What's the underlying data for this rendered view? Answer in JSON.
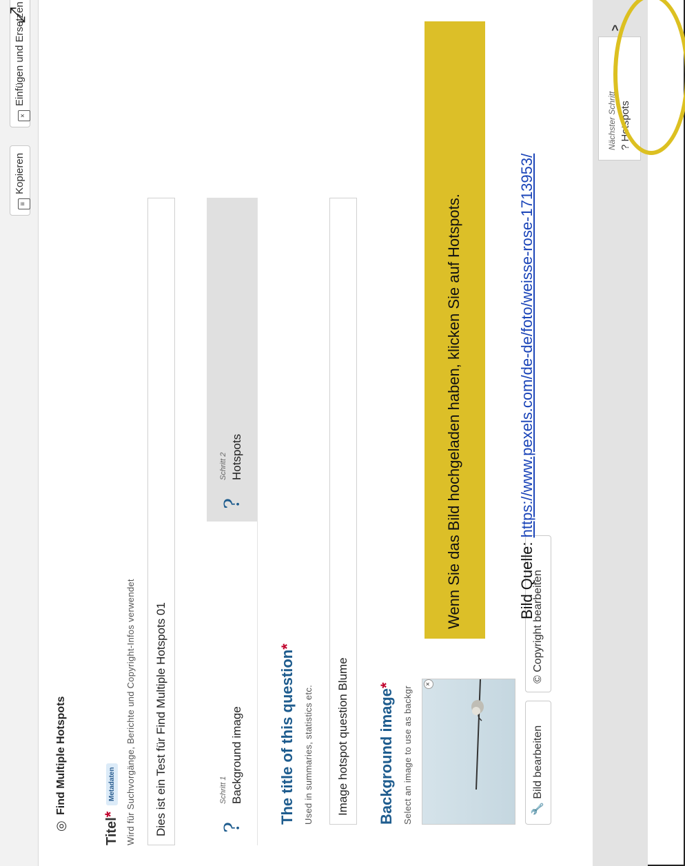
{
  "toolbar": {
    "copy_label": "Kopieren",
    "paste_label": "Einfügen und Ersetzen"
  },
  "editor": {
    "content_type_title": "Find Multiple Hotspots",
    "title_label": "Titel",
    "metadata_badge": "Metadaten",
    "title_hint": "Wird für Suchvorgänge, Berichte und Copyright-Infos verwendet",
    "title_value": "Dies ist ein Test für Find Multiple Hotspots 01",
    "required_mark": "*"
  },
  "steps": [
    {
      "step_label": "Schritt 1",
      "name": "Background image",
      "icon": "?"
    },
    {
      "step_label": "Schritt 2",
      "name": "Hotspots",
      "icon": "?"
    }
  ],
  "question": {
    "label": "The title of this question",
    "hint": "Used in summaries, statistics etc.",
    "value": "Image hotspot question Blume"
  },
  "background": {
    "label": "Background image",
    "hint": "Select an image to use as backgr",
    "edit_image_label": "Bild bearbeiten",
    "edit_copyright_label": "Copyright bearbeiten"
  },
  "next_step": {
    "caption": "Nächster Schritt",
    "value": "? Hotspots",
    "chevron": "^"
  },
  "annotation": {
    "instruction": "Wenn Sie das Bild hochgeladen haben, klicken Sie auf Hotspots.",
    "source_label": "Bild Quelle: ",
    "source_url": "https://www.pexels.com/de-de/foto/weisse-rose-1713953/",
    "highlight_color": "#dcbf28"
  }
}
